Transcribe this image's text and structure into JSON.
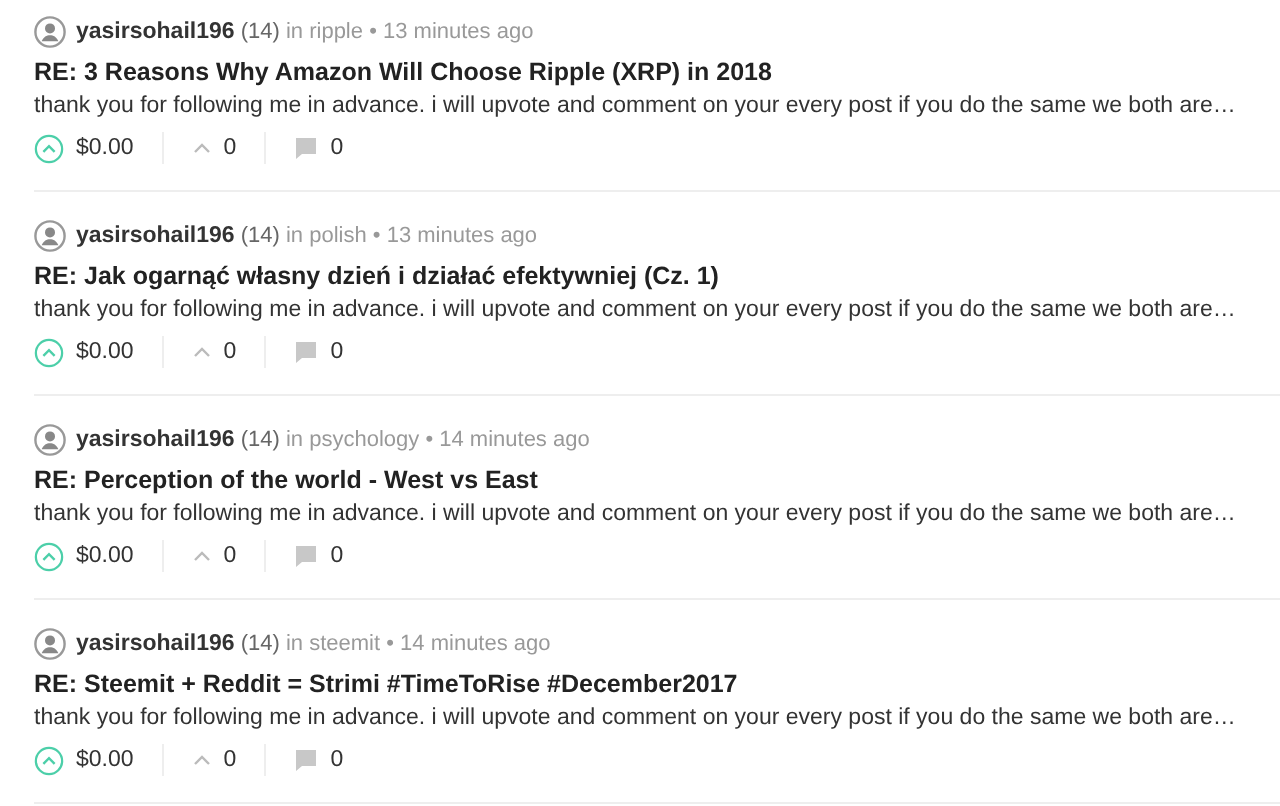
{
  "posts": [
    {
      "author": "yasirsohail196",
      "reputation": "(14)",
      "in_label": "in",
      "category": "ripple",
      "separator": "•",
      "time": "13 minutes ago",
      "title": "RE: 3 Reasons Why Amazon Will Choose Ripple (XRP) in 2018",
      "body": "thank you for following me in advance. i will upvote and comment on your every post if you do the same we both are…",
      "payout": "$0.00",
      "votes": "0",
      "comments": "0"
    },
    {
      "author": "yasirsohail196",
      "reputation": "(14)",
      "in_label": "in",
      "category": "polish",
      "separator": "•",
      "time": "13 minutes ago",
      "title": "RE: Jak ogarnąć własny dzień i działać efektywniej (Cz. 1)",
      "body": "thank you for following me in advance. i will upvote and comment on your every post if you do the same we both are…",
      "payout": "$0.00",
      "votes": "0",
      "comments": "0"
    },
    {
      "author": "yasirsohail196",
      "reputation": "(14)",
      "in_label": "in",
      "category": "psychology",
      "separator": "•",
      "time": "14 minutes ago",
      "title": "RE: Perception of the world - West vs East",
      "body": "thank you for following me in advance. i will upvote and comment on your every post if you do the same we both are…",
      "payout": "$0.00",
      "votes": "0",
      "comments": "0"
    },
    {
      "author": "yasirsohail196",
      "reputation": "(14)",
      "in_label": "in",
      "category": "steemit",
      "separator": "•",
      "time": "14 minutes ago",
      "title": "RE: Steemit + Reddit = Strimi #TimeToRise #December2017",
      "body": "thank you for following me in advance. i will upvote and comment on your every post if you do the same we both are…",
      "payout": "$0.00",
      "votes": "0",
      "comments": "0"
    }
  ]
}
